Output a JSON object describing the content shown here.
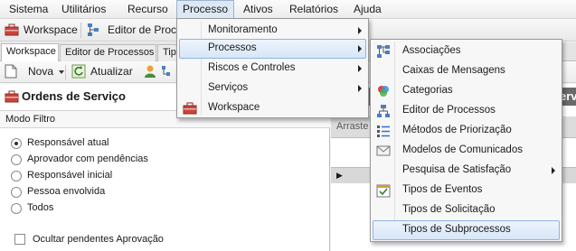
{
  "menubar": [
    "Sistema",
    "Utilitários",
    "Recurso",
    "Processo",
    "Ativos",
    "Relatórios",
    "Ajuda"
  ],
  "toolbar1": {
    "workspace": "Workspace",
    "editor": "Editor de Proc"
  },
  "tabs": [
    "Workspace",
    "Editor de Processos",
    "Tip"
  ],
  "toolbar2": {
    "nova": "Nova",
    "atualizar": "Atualizar"
  },
  "panel": {
    "title": "Ordens de Serviço",
    "modo_filtro": "Modo Filtro",
    "radios": [
      "Responsável atual",
      "Aprovador com pendências",
      "Responsável inicial",
      "Pessoa envolvida",
      "Todos"
    ],
    "selected_index": 0,
    "checkbox_label": "Ocultar pendentes Aprovação"
  },
  "right": {
    "header_fragment": "erv",
    "arraste": "Arraste"
  },
  "processo_menu": [
    "Monitoramento",
    "Processos",
    "Riscos e Controles",
    "Serviços",
    "Workspace"
  ],
  "processos_submenu": [
    "Associações",
    "Caixas de Mensagens",
    "Categorias",
    "Editor de Processos",
    "Métodos de Priorização",
    "Modelos de Comunicados",
    "Pesquisa de Satisfação",
    "Tipos de Eventos",
    "Tipos de Solicitação",
    "Tipos de Subprocessos"
  ]
}
